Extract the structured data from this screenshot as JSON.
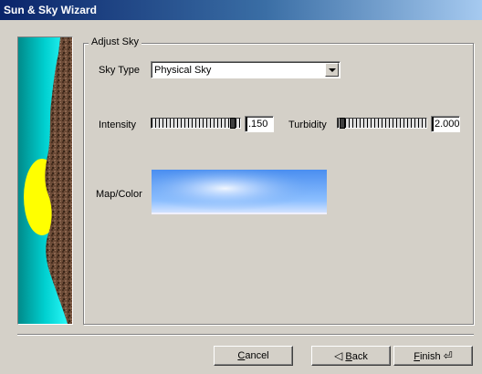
{
  "window": {
    "title": "Sun & Sky Wizard"
  },
  "group": {
    "title": "Adjust Sky"
  },
  "sky_type": {
    "label": "Sky Type",
    "value": "Physical Sky"
  },
  "intensity": {
    "label": "Intensity",
    "value": ".150",
    "slider_level": 0.95
  },
  "turbidity": {
    "label": "Turbidity",
    "value": "2.000",
    "slider_level": 0.02
  },
  "map_color": {
    "label": "Map/Color"
  },
  "buttons": {
    "cancel_label": "Cancel",
    "cancel_mnemonic": "C",
    "cancel_rest": "ancel",
    "back_mnemonic": "B",
    "back_rest": "ack",
    "back_icon": "◁",
    "finish_mnemonic": "F",
    "finish_rest": "inish",
    "finish_icon": "⏎"
  },
  "icons": {
    "back": "back-arrow-icon",
    "finish": "enter-arrow-icon",
    "dropdown": "chevron-down-icon"
  },
  "colors": {
    "title_start": "#0a246a",
    "panel_bg": "#d4d0c8",
    "sky_blue": "#6aa6f0",
    "sun_yellow": "#ffff00",
    "cyan": "#00c8c8"
  }
}
